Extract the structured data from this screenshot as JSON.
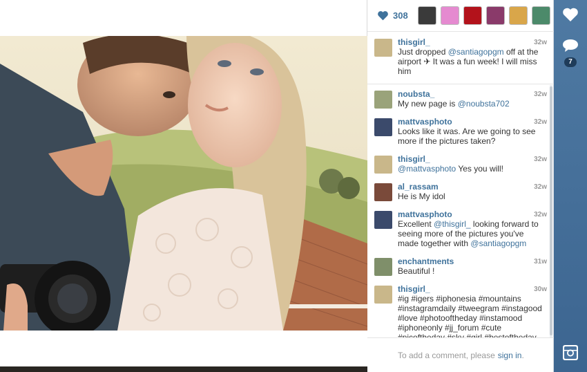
{
  "likes": {
    "count": "308"
  },
  "caption": {
    "user": "thisgirl_",
    "time": "32w",
    "text_a": "Just dropped ",
    "mention": "@santiagopgm",
    "text_b": " off at the airport ✈ It was a fun week! I will miss him"
  },
  "comments": [
    {
      "user": "noubsta_",
      "time": "32w",
      "a": "My new page is ",
      "m1": "@noubsta702",
      "b": "",
      "m2": "",
      "c": ""
    },
    {
      "user": "mattvasphoto",
      "time": "32w",
      "a": "Looks like it was. Are we going to see more if the pictures taken?",
      "m1": "",
      "b": "",
      "m2": "",
      "c": ""
    },
    {
      "user": "thisgirl_",
      "time": "32w",
      "a": "",
      "m1": "@mattvasphoto",
      "b": " Yes you will!",
      "m2": "",
      "c": ""
    },
    {
      "user": "al_rassam",
      "time": "32w",
      "a": "He is My idol",
      "m1": "",
      "b": "",
      "m2": "",
      "c": ""
    },
    {
      "user": "mattvasphoto",
      "time": "32w",
      "a": "Excellent ",
      "m1": "@thisgirl_",
      "b": " looking forward to seeing more of the pictures you've made together with ",
      "m2": "@santiagopgm",
      "c": ""
    },
    {
      "user": "enchantments",
      "time": "31w",
      "a": "Beautiful !",
      "m1": "",
      "b": "",
      "m2": "",
      "c": ""
    },
    {
      "user": "thisgirl_",
      "time": "30w",
      "a": "#ig #igers #iphonesia #mountains #instagramdaily #tweegram #instagood #love #photooftheday #instamood #iphoneonly #jj_forum #cute #picoftheday #sky #girl #bestoftheday",
      "m1": "",
      "b": "",
      "m2": "",
      "c": ""
    }
  ],
  "add_comment": {
    "prompt": "To add a comment, please",
    "link": "sign in",
    "end": "."
  },
  "rail": {
    "comment_count": "7"
  },
  "colors": {
    "link": "#3f729b",
    "rail": "#4a74a0"
  }
}
